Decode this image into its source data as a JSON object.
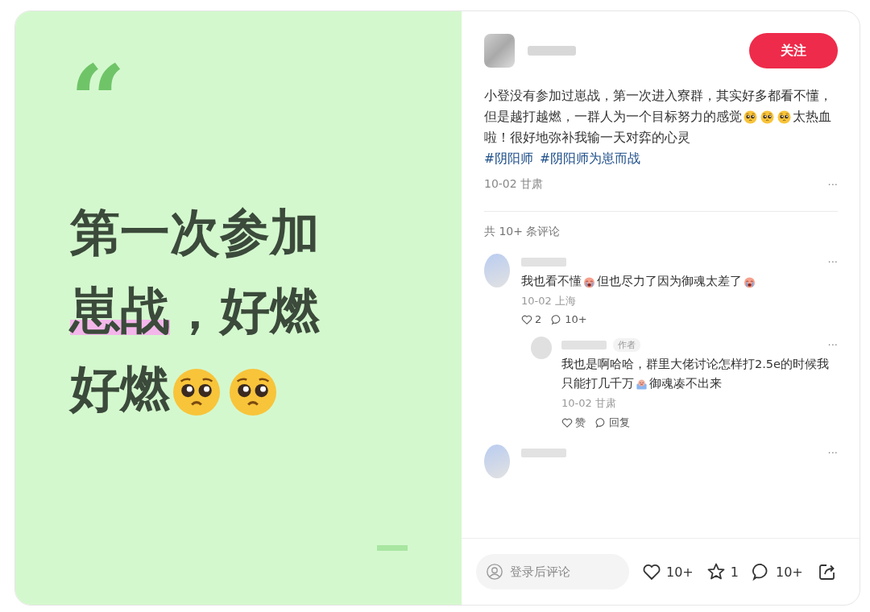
{
  "cover": {
    "quote_mark": "“",
    "headline": [
      {
        "kind": "text",
        "text": "第一次参加"
      },
      {
        "kind": "highlight",
        "text": "崽战"
      },
      {
        "kind": "text",
        "text": "，好燃好燃"
      },
      {
        "kind": "pleading-face"
      },
      {
        "kind": "pleading-face"
      }
    ]
  },
  "post": {
    "follow_button": "关注",
    "body": [
      {
        "kind": "text",
        "text": "小登没有参加过崽战，第一次进入寮群，其实好多都看不懂，但是越打越燃，一群人为一个目标努力的感觉"
      },
      {
        "kind": "pleading-face"
      },
      {
        "kind": "pleading-face"
      },
      {
        "kind": "pleading-face"
      },
      {
        "kind": "text",
        "text": "太热血啦！很好地弥补我输一天对弈的心灵"
      }
    ],
    "tags": [
      "#阴阳师",
      "#阴阳师为崽而战"
    ],
    "meta": "10-02 甘肃",
    "more": "···"
  },
  "comments": {
    "count_label": "共 10+ 条评论",
    "items": [
      {
        "text": [
          {
            "kind": "text",
            "text": "我也看不懂"
          },
          {
            "kind": "crying-face"
          },
          {
            "kind": "text",
            "text": "但也尽力了因为御魂太差了"
          },
          {
            "kind": "crying-face"
          }
        ],
        "meta": "10-02 上海",
        "like_label": "2",
        "reply_label": "10+",
        "more": "···",
        "replies": [
          {
            "badge": "作者",
            "text": [
              {
                "kind": "text",
                "text": "我也是啊哈哈，群里大佬讨论怎样打2.5e的时候我只能打几千万"
              },
              {
                "kind": "sad-face"
              },
              {
                "kind": "text",
                "text": "御魂凑不出来"
              }
            ],
            "meta": "10-02 甘肃",
            "like_label": "赞",
            "reply_label": "回复",
            "more": "···"
          }
        ]
      },
      {
        "more": "···"
      }
    ]
  },
  "bottom_bar": {
    "comment_field": {
      "placeholder": "登录后评论"
    },
    "likes": "10+",
    "favorites": "1",
    "comments": "10+"
  }
}
